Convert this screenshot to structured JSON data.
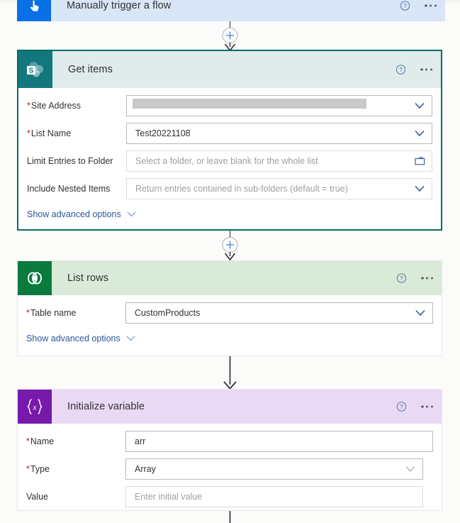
{
  "flow": {
    "steps": [
      {
        "id": "trigger",
        "title": "Manually trigger a flow",
        "icon": "hand-pointer-icon",
        "icon_color": "#0a70e8",
        "header_color": "#d9e6f7",
        "help_label": "?",
        "menu_label": "..."
      },
      {
        "id": "get-items",
        "title": "Get items",
        "icon": "sharepoint-icon",
        "icon_color": "#12787d",
        "header_color": "#dfeceb",
        "border_color": "#096b69",
        "selected": "true",
        "help_label": "?",
        "menu_label": "...",
        "fields": [
          {
            "label": "Site Address",
            "required": true,
            "value": "",
            "redacted": true,
            "control": "dropdown"
          },
          {
            "label": "List Name",
            "required": true,
            "value": "Test20221108",
            "control": "dropdown"
          },
          {
            "label": "Limit Entries to Folder",
            "required": false,
            "placeholder": "Select a folder, or leave blank for the whole list",
            "control": "folder-picker"
          },
          {
            "label": "Include Nested Items",
            "required": false,
            "placeholder": "Return entries contained in sub-folders (default = true)",
            "control": "dropdown"
          }
        ],
        "advanced_label": "Show advanced options"
      },
      {
        "id": "list-rows",
        "title": "List rows",
        "icon": "dataverse-icon",
        "icon_color": "#0b7a3e",
        "header_color": "#d9ead9",
        "help_label": "?",
        "menu_label": "...",
        "fields": [
          {
            "label": "Table name",
            "required": true,
            "value": "CustomProducts",
            "control": "dropdown"
          }
        ],
        "advanced_label": "Show advanced options"
      },
      {
        "id": "initialize-variable",
        "title": "Initialize variable",
        "icon": "variable-braces-icon",
        "icon_color": "#7719aa",
        "header_color": "#e9d9f5",
        "help_label": "?",
        "menu_label": "...",
        "fields": [
          {
            "label": "Name",
            "required": true,
            "value": "arr",
            "control": "text"
          },
          {
            "label": "Type",
            "required": true,
            "value": "Array",
            "control": "dropdown"
          },
          {
            "label": "Value",
            "required": false,
            "placeholder": "Enter initial value",
            "control": "text"
          }
        ]
      }
    ],
    "connectors": [
      {
        "id": "connector-1",
        "has_add_button": true,
        "add_label": "+"
      },
      {
        "id": "connector-2",
        "has_add_button": true,
        "add_label": "+"
      },
      {
        "id": "connector-3",
        "has_add_button": false
      },
      {
        "id": "connector-4",
        "has_add_button": false
      }
    ]
  },
  "colors": {
    "accent": "#0a70e8",
    "selected_border": "#096b69",
    "required": "#a4262c",
    "link": "#2b579a"
  }
}
